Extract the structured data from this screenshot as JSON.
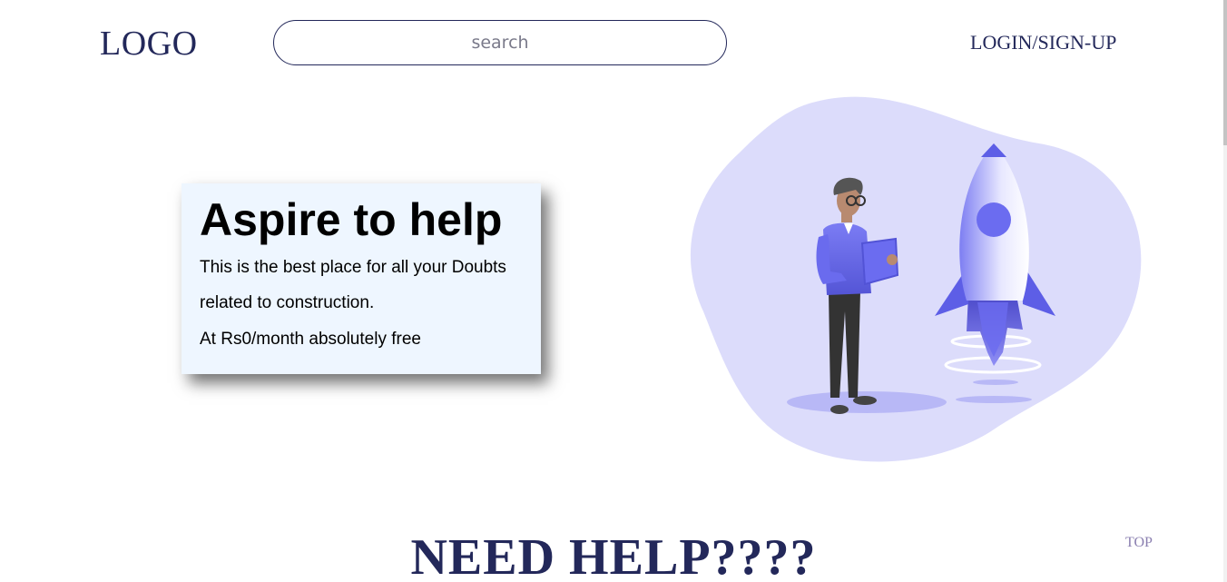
{
  "header": {
    "logo_text": "LOGO",
    "search_placeholder": "search",
    "login_label": "LOGIN/SIGN-UP"
  },
  "hero": {
    "title": "Aspire to help",
    "line1": "This is the best place for all your Doubts",
    "line2": "related to construction.",
    "line3": "At Rs0/month absolutely free"
  },
  "section": {
    "heading": "NEED HELP????"
  },
  "top_link": "TOP",
  "colors": {
    "brand_navy": "#23285a",
    "blob": "#dcdcfb",
    "accent_purple": "#6b6cf0",
    "card_bg": "#eef6ff"
  },
  "icons": {
    "illustration": "man-with-tablet-and-rocket-illustration"
  }
}
